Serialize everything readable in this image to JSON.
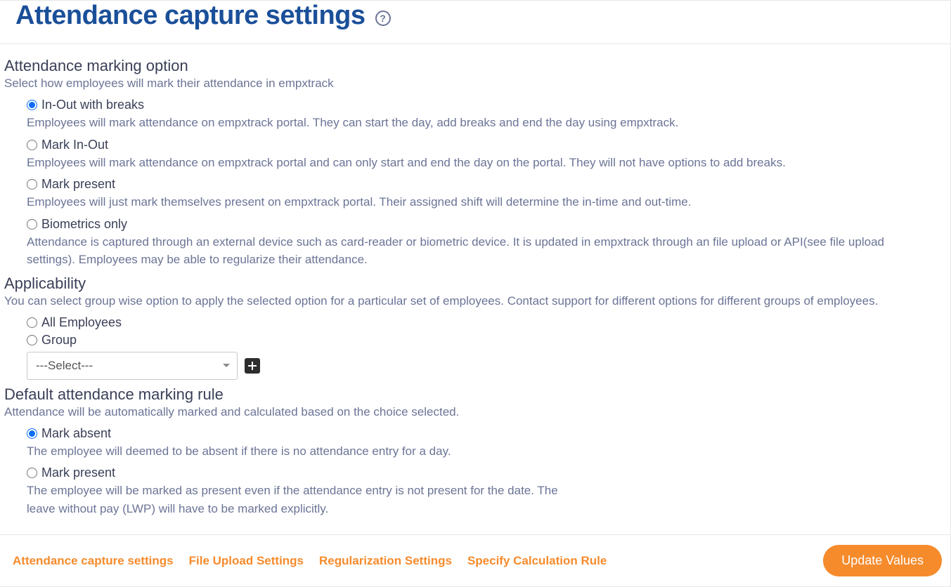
{
  "header": {
    "title": "Attendance capture settings",
    "help_symbol": "?"
  },
  "sections": {
    "marking": {
      "title": "Attendance marking option",
      "sub": "Select how employees will mark their attendance in empxtrack",
      "options": [
        {
          "label": "In-Out with breaks",
          "desc": "Employees will mark attendance on empxtrack portal. They can start the day, add breaks and end the day using empxtrack.",
          "checked": true
        },
        {
          "label": "Mark In-Out",
          "desc": "Employees will mark attendance on empxtrack portal and can only start and end the day on the portal. They will not have options to add breaks.",
          "checked": false
        },
        {
          "label": "Mark present",
          "desc": "Employees will just mark themselves present on empxtrack portal. Their assigned shift will determine the in-time and out-time.",
          "checked": false
        },
        {
          "label": "Biometrics only",
          "desc": "Attendance is captured through an external device such as card-reader or biometric device. It is updated in empxtrack through an file upload or API(see file upload settings). Employees may be able to regularize their attendance.",
          "checked": false
        }
      ]
    },
    "applicability": {
      "title": "Applicability",
      "sub": "You can select group wise option to apply the selected option for a particular set of employees. Contact support for different options for different groups of employees.",
      "options": [
        {
          "label": "All Employees",
          "checked": false
        },
        {
          "label": "Group",
          "checked": false
        }
      ],
      "select_placeholder": "---Select---"
    },
    "default_rule": {
      "title": "Default attendance marking rule",
      "sub": "Attendance will be automatically marked and calculated based on the choice selected.",
      "options": [
        {
          "label": "Mark absent",
          "desc": "The employee will deemed to be absent if there is no attendance entry for a day.",
          "checked": true
        },
        {
          "label": "Mark present",
          "desc": "The employee will be marked as present even if the attendance entry is not present for the date. The leave without pay (LWP) will have to be marked explicitly.",
          "checked": false
        }
      ]
    }
  },
  "footer": {
    "links": [
      "Attendance capture settings",
      "File Upload Settings",
      "Regularization Settings",
      "Specify Calculation Rule"
    ],
    "update_button": "Update Values"
  }
}
